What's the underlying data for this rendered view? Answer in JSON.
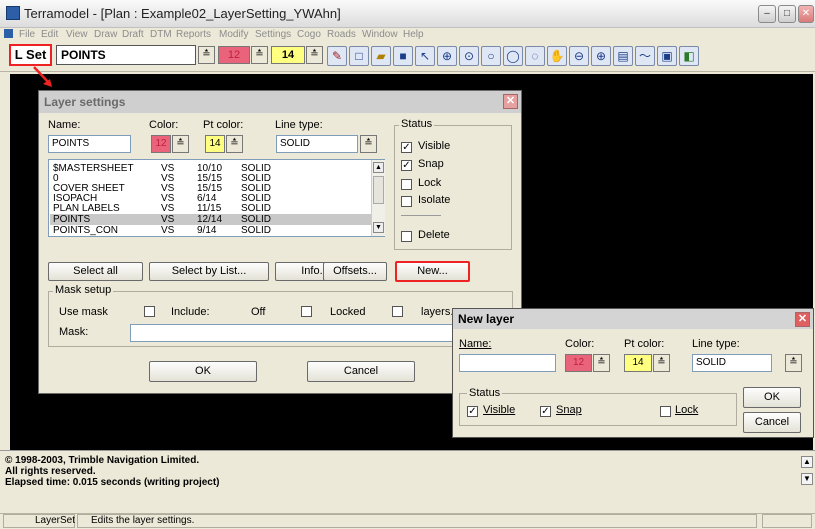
{
  "window": {
    "title": "Terramodel - [Plan : Example02_LayerSetting_YWAhn]",
    "min": "–",
    "max": "□",
    "close": "✕"
  },
  "menu": {
    "items": [
      "File",
      "Edit",
      "View",
      "Draw",
      "Draft",
      "DTM",
      "Reports",
      "Modify",
      "Settings",
      "Cogo",
      "Roads",
      "Window",
      "Help"
    ]
  },
  "toolbar": {
    "lset_label": "L Set",
    "layer_value": "POINTS",
    "color_value": "12",
    "ptcolor_value": "14",
    "spin_glyph": "≛"
  },
  "layer_dialog": {
    "title": "Layer settings",
    "close": "✕",
    "name_label": "Name:",
    "name_value": "POINTS",
    "color_label": "Color:",
    "color_value": "12",
    "ptcolor_label": "Pt color:",
    "ptcolor_value": "14",
    "linetype_label": "Line type:",
    "linetype_value": "SOLID",
    "layers": [
      {
        "name": "$MASTERSHEET",
        "flags": "VS",
        "color": "10/10",
        "type": "SOLID"
      },
      {
        "name": "0",
        "flags": "VS",
        "color": "15/15",
        "type": "SOLID"
      },
      {
        "name": "COVER SHEET",
        "flags": "VS",
        "color": "15/15",
        "type": "SOLID"
      },
      {
        "name": "ISOPACH",
        "flags": "VS",
        "color": "6/14",
        "type": "SOLID"
      },
      {
        "name": "PLAN LABELS",
        "flags": "VS",
        "color": "11/15",
        "type": "SOLID"
      },
      {
        "name": "POINTS",
        "flags": "VS",
        "color": "12/14",
        "type": "SOLID"
      },
      {
        "name": "POINTS_CON",
        "flags": "VS",
        "color": "9/14",
        "type": "SOLID"
      }
    ],
    "status_label": "Status",
    "visible_label": "Visible",
    "snap_label": "Snap",
    "lock_label": "Lock",
    "isolate_label": "Isolate",
    "delete_label": "Delete",
    "check": "✓",
    "select_all": "Select all",
    "select_by_list": "Select by List...",
    "info": "Info...",
    "offsets": "Offsets...",
    "new": "New...",
    "mask_setup_label": "Mask setup",
    "use_mask_label": "Use mask",
    "include_label": "Include:",
    "off_label": "Off",
    "locked_label": "Locked",
    "layers_label": "layers.",
    "mask_label": "Mask:",
    "ok": "OK",
    "cancel": "Cancel"
  },
  "new_dialog": {
    "title": "New layer",
    "close": "✕",
    "name_label": "Name:",
    "color_label": "Color:",
    "color_value": "12",
    "ptcolor_label": "Pt color:",
    "ptcolor_value": "14",
    "linetype_label": "Line type:",
    "linetype_value": "SOLID",
    "status_label": "Status",
    "visible_label": "Visible",
    "snap_label": "Snap",
    "lock_label": "Lock",
    "ok": "OK",
    "cancel": "Cancel"
  },
  "output": {
    "line1": "© 1998-2003, Trimble Navigation Limited.",
    "line2": "All rights reserved.",
    "line3": "Elapsed time: 0.015 seconds (writing project)",
    "up": "▲",
    "down": "▼"
  },
  "statusbar": {
    "command": "LayerSet",
    "description": "Edits the layer settings."
  },
  "colors": {
    "color12": "#e9637a",
    "color14": "#ffff80",
    "accent_red": "#e22222"
  }
}
